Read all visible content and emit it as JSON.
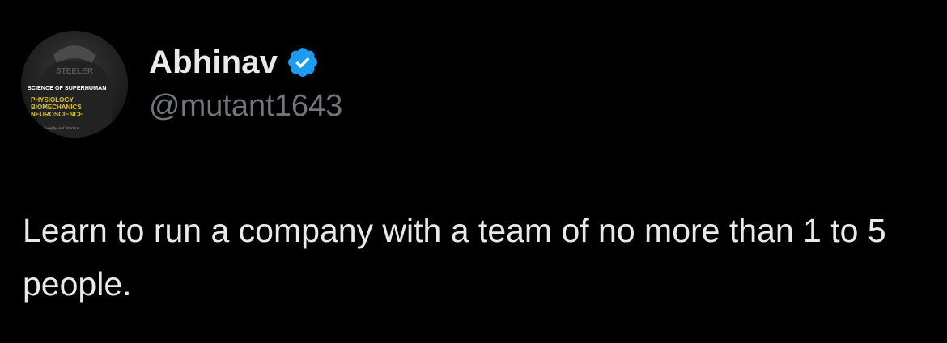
{
  "author": {
    "display_name": "Abhinav",
    "handle": "@mutant1643",
    "verified": true,
    "verified_icon": "verified-badge-icon",
    "verified_color": "#1d9bf0",
    "avatar": {
      "top_lettering": "STEELER",
      "banner_text": "SCIENCE OF SUPERHUMAN",
      "lines": [
        "PHYSIOLOGY",
        "BIOMECHANICS",
        "NEUROSCIENCE"
      ],
      "footer_text": "Philosophy and Practice"
    }
  },
  "tweet": {
    "text": "Learn to run a company with a team of no more than 1 to 5 people."
  },
  "colors": {
    "background": "#000000",
    "text_primary": "#e7e9ea",
    "text_secondary": "#71767b",
    "avatar_text_accent": "#d9c23a"
  }
}
